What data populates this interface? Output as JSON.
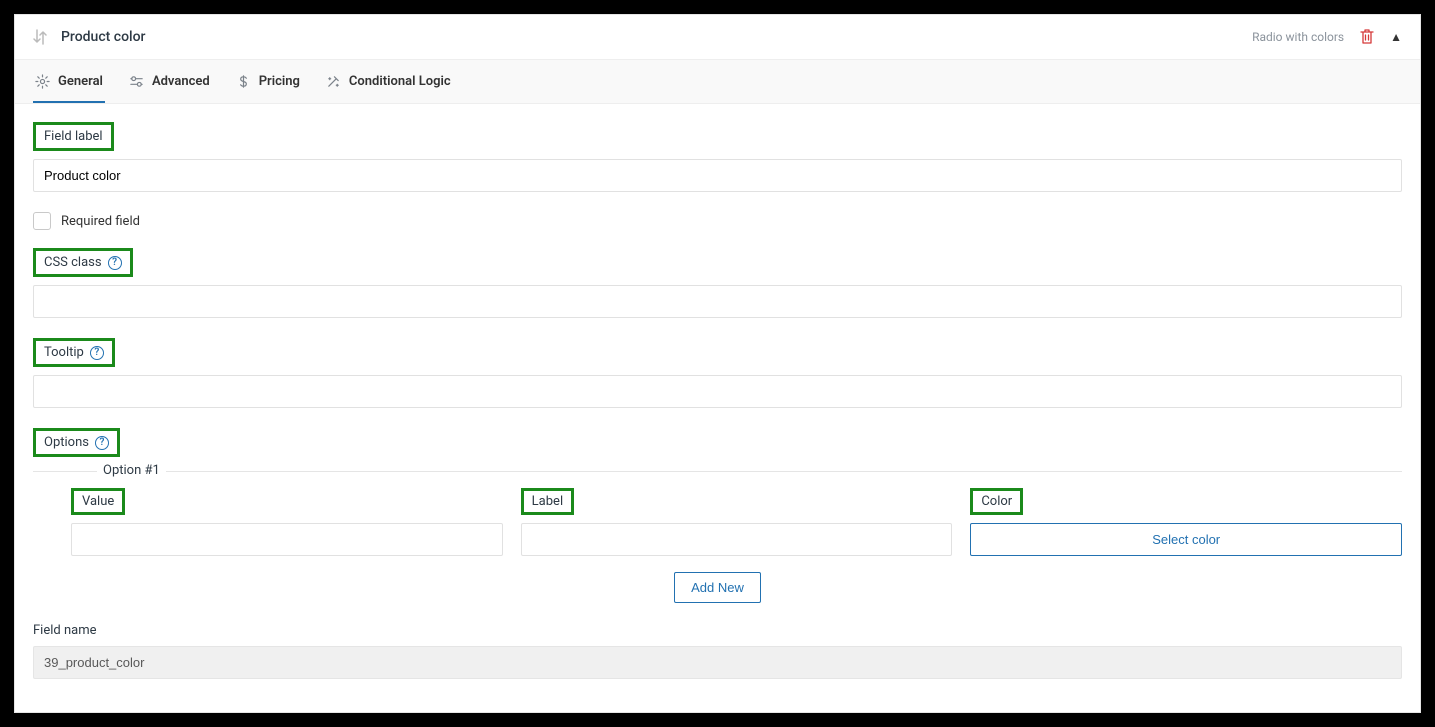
{
  "header": {
    "title": "Product color",
    "field_type": "Radio with colors"
  },
  "tabs": [
    {
      "label": "General"
    },
    {
      "label": "Advanced"
    },
    {
      "label": "Pricing"
    },
    {
      "label": "Conditional Logic"
    }
  ],
  "form": {
    "field_label_label": "Field label",
    "field_label_value": "Product color",
    "required_label": "Required field",
    "css_class_label": "CSS class",
    "css_class_value": "",
    "tooltip_label": "Tooltip",
    "tooltip_value": "",
    "options_label": "Options",
    "option_legend": "Option #1",
    "option_headers": {
      "value": "Value",
      "label": "Label",
      "color": "Color"
    },
    "option_values": {
      "value": "",
      "label": ""
    },
    "select_color_btn": "Select color",
    "add_new_btn": "Add New",
    "field_name_label": "Field name",
    "field_name_value": "39_product_color"
  }
}
